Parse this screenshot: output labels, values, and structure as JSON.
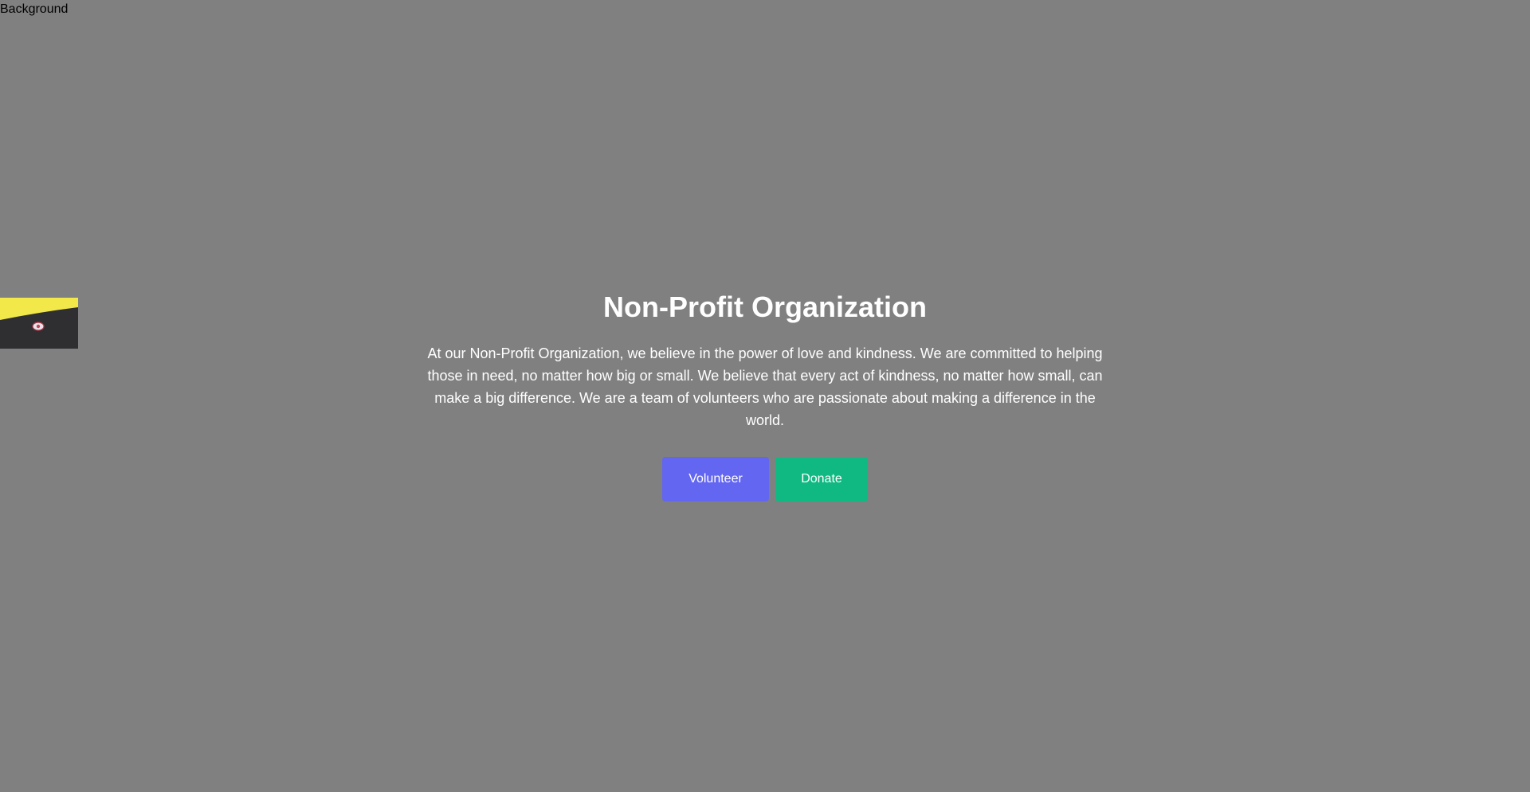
{
  "background_label": "Background",
  "thumbnail": {
    "icon": "eye-logo-icon"
  },
  "hero": {
    "title": "Non-Profit Organization",
    "description": "At our Non-Profit Organization, we believe in the power of love and kindness. We are committed to helping those in need, no matter how big or small. We believe that every act of kindness, no matter how small, can make a big difference. We are a team of volunteers who are passionate about making a difference in the world.",
    "buttons": {
      "volunteer": {
        "label": "Volunteer",
        "color": "#6366f1"
      },
      "donate": {
        "label": "Donate",
        "color": "#10b981"
      }
    }
  },
  "colors": {
    "page_background": "#808080",
    "text": "#ffffff"
  }
}
